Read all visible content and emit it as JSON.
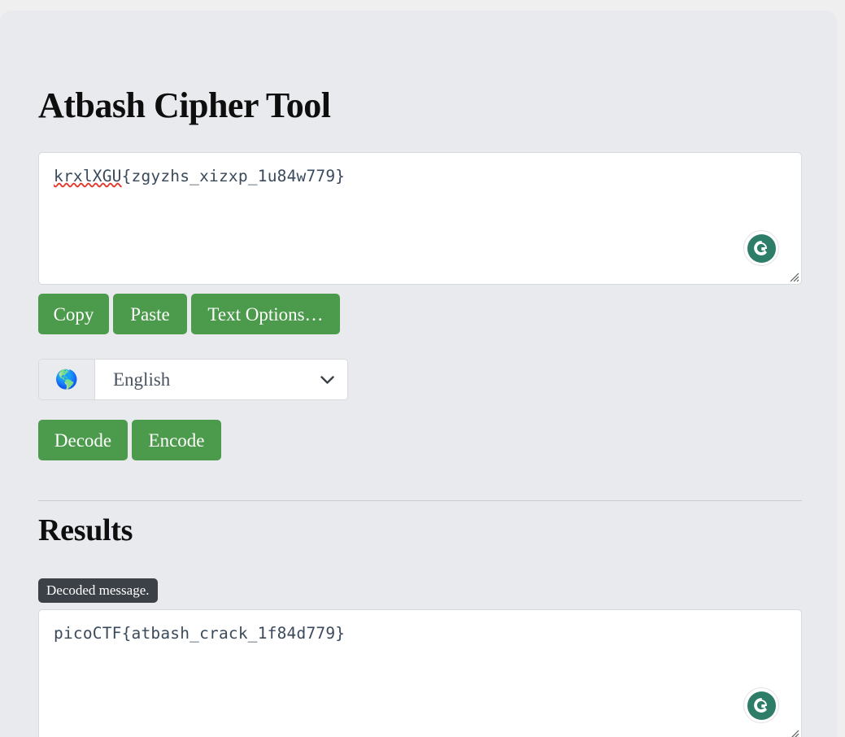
{
  "page": {
    "title": "Atbash Cipher Tool",
    "results_heading": "Results"
  },
  "input": {
    "value": "krxlXGU{zgyzhs_xizxp_1u84w779}",
    "misspelled_segment": "krxlXGU",
    "rest_segment": "{zgyzhs_xizxp_1u84w779}",
    "placeholder": "",
    "assistant_icon": "grammarly-icon"
  },
  "toolbar": {
    "copy_label": "Copy",
    "paste_label": "Paste",
    "text_options_label": "Text Options…"
  },
  "language": {
    "icon": "globe-icon",
    "icon_glyph": "🌎",
    "selected": "English",
    "options": [
      "English"
    ],
    "chevron": "chevron-down-icon"
  },
  "actions": {
    "decode_label": "Decode",
    "encode_label": "Encode"
  },
  "results": {
    "status_badge": "Decoded message.",
    "value": "picoCTF{atbash_crack_1f84d779}",
    "assistant_icon": "grammarly-icon"
  },
  "colors": {
    "button_green": "#4c9a4c",
    "badge_dark": "#3c4148",
    "page_bg": "#e8eaed",
    "top_strip": "#f0eff0",
    "grammarly_green": "#2e7d68",
    "text_mono": "#3a4a5c",
    "spellcheck_red": "#e23b2e"
  }
}
